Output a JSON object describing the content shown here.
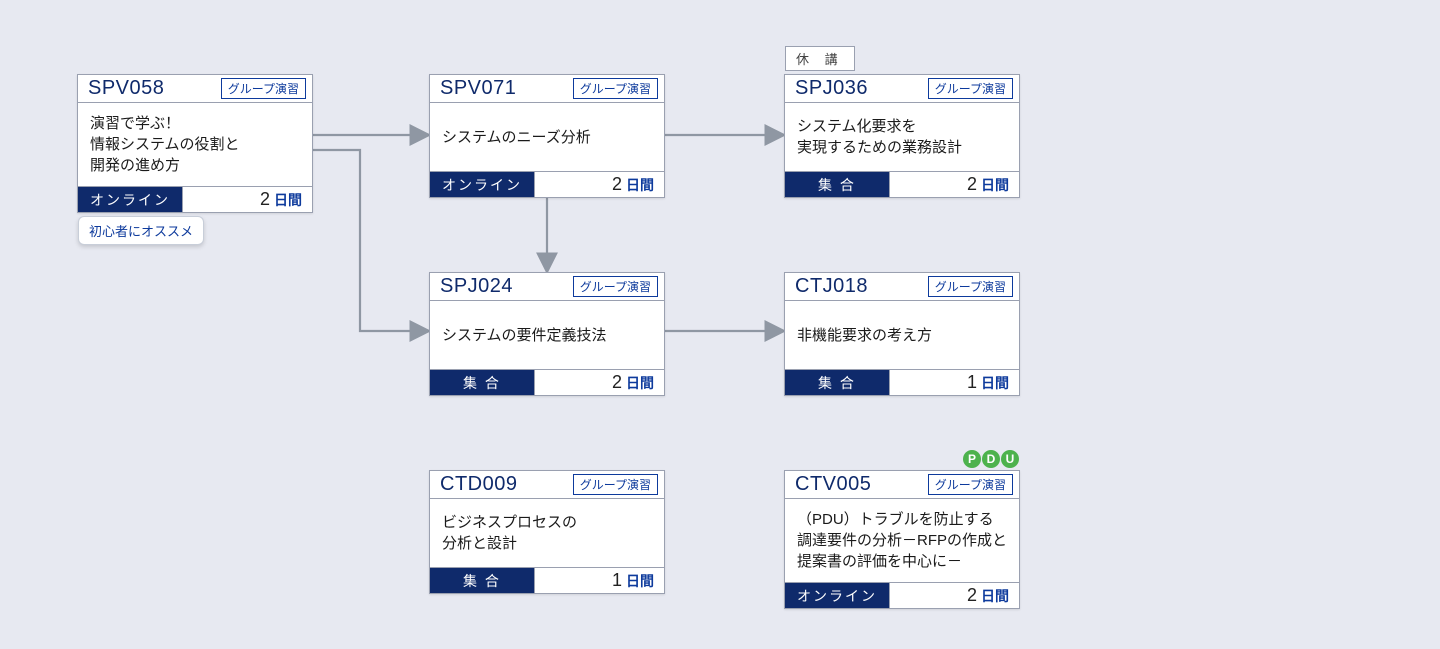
{
  "group_tag": "グループ演習",
  "days_unit": "日間",
  "beginner_label": "初心者にオススメ",
  "suspended_label": "休 講",
  "pdu_label": "PDU",
  "cards": {
    "spv058": {
      "code": "SPV058",
      "title": "演習で学ぶ！\n情報システムの役割と\n開発の進め方",
      "mode": "オンライン",
      "days": "2"
    },
    "spv071": {
      "code": "SPV071",
      "title": "システムのニーズ分析",
      "mode": "オンライン",
      "days": "2"
    },
    "spj036": {
      "code": "SPJ036",
      "title": "システム化要求を\n実現するための業務設計",
      "mode": "集 合",
      "days": "2"
    },
    "spj024": {
      "code": "SPJ024",
      "title": "システムの要件定義技法",
      "mode": "集 合",
      "days": "2"
    },
    "ctj018": {
      "code": "CTJ018",
      "title": "非機能要求の考え方",
      "mode": "集 合",
      "days": "1"
    },
    "ctd009": {
      "code": "CTD009",
      "title": "ビジネスプロセスの\n分析と設計",
      "mode": "集 合",
      "days": "1"
    },
    "ctv005": {
      "code": "CTV005",
      "title": "（PDU）トラブルを防止する\n調達要件の分析－RFPの作成と\n提案書の評価を中心に－",
      "mode": "オンライン",
      "days": "2"
    }
  }
}
